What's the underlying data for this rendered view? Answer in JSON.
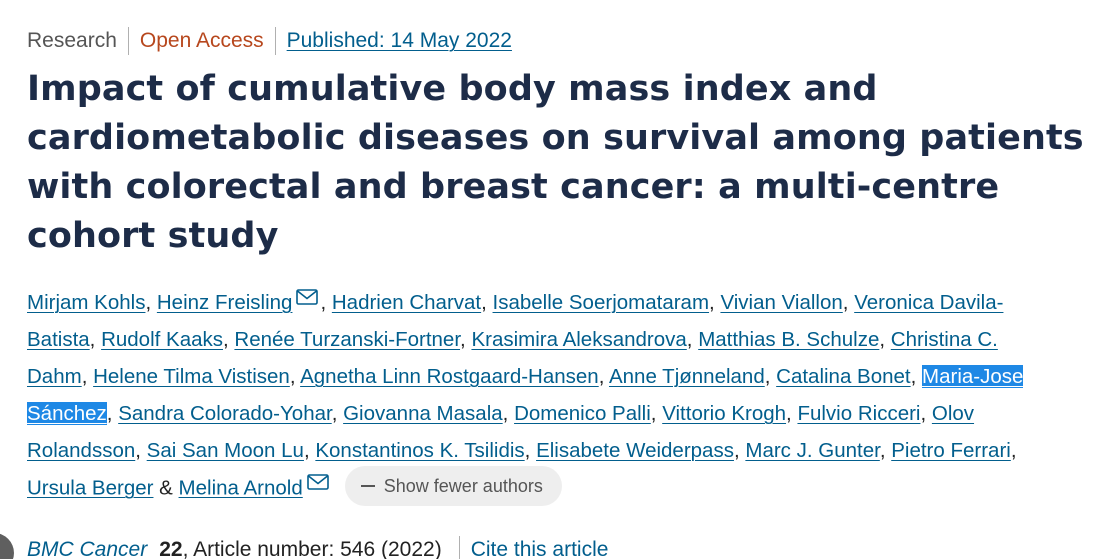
{
  "meta": {
    "article_type": "Research",
    "access": "Open Access",
    "published": "Published: 14 May 2022"
  },
  "title": "Impact of cumulative body mass index and cardiometabolic diseases on survival among patients with colorectal and breast cancer: a multi-centre cohort study",
  "authors": [
    {
      "name": "Mirjam Kohls",
      "sep": ", "
    },
    {
      "name": "Heinz Freisling",
      "mail": true,
      "sep": ", "
    },
    {
      "name": "Hadrien Charvat",
      "sep": ", "
    },
    {
      "name": "Isabelle Soerjomataram",
      "sep": ", "
    },
    {
      "name": "Vivian Viallon",
      "sep": ", "
    },
    {
      "name": "Veronica Davila-Batista",
      "sep": ", "
    },
    {
      "name": "Rudolf Kaaks",
      "sep": ", "
    },
    {
      "name": "Renée Turzanski-Fortner",
      "sep": ", "
    },
    {
      "name": "Krasimira Aleksandrova",
      "sep": ", "
    },
    {
      "name": "Matthias B. Schulze",
      "sep": ", "
    },
    {
      "name": "Christina C. Dahm",
      "sep": ", "
    },
    {
      "name": "Helene Tilma Vistisen",
      "sep": ", "
    },
    {
      "name": "Agnetha Linn Rostgaard-Hansen",
      "sep": ", "
    },
    {
      "name": "Anne Tjønneland",
      "sep": ", "
    },
    {
      "name": "Catalina Bonet",
      "sep": ", "
    },
    {
      "name": "Maria-Jose Sánchez",
      "selected": true,
      "sep": ", "
    },
    {
      "name": "Sandra Colorado-Yohar",
      "sep": ", "
    },
    {
      "name": "Giovanna Masala",
      "sep": ", "
    },
    {
      "name": "Domenico Palli",
      "sep": ", "
    },
    {
      "name": "Vittorio Krogh",
      "sep": ", "
    },
    {
      "name": "Fulvio Ricceri",
      "sep": ", "
    },
    {
      "name": "Olov Rolandsson",
      "sep": ", "
    },
    {
      "name": "Sai San Moon Lu",
      "sep": ", "
    },
    {
      "name": "Konstantinos K. Tsilidis",
      "sep": ", "
    },
    {
      "name": "Elisabete Weiderpass",
      "sep": ", "
    },
    {
      "name": "Marc J. Gunter",
      "sep": ", "
    },
    {
      "name": "Pietro Ferrari",
      "sep": ", "
    },
    {
      "name": "Ursula Berger",
      "sep": " & "
    },
    {
      "name": "Melina Arnold",
      "mail": true,
      "sep": ""
    }
  ],
  "show_fewer_label": "Show fewer authors",
  "icons": {
    "mail": "mail-icon",
    "minus": "minus-icon"
  },
  "journal": {
    "name": "BMC Cancer",
    "volume": "22",
    "article_number": ", Article number: 546 (2022)",
    "cite_label": "Cite this article"
  },
  "colors": {
    "link": "#025e8d",
    "title": "#1d2c48",
    "open_access": "#b7471d",
    "selection": "#1e88e5"
  }
}
